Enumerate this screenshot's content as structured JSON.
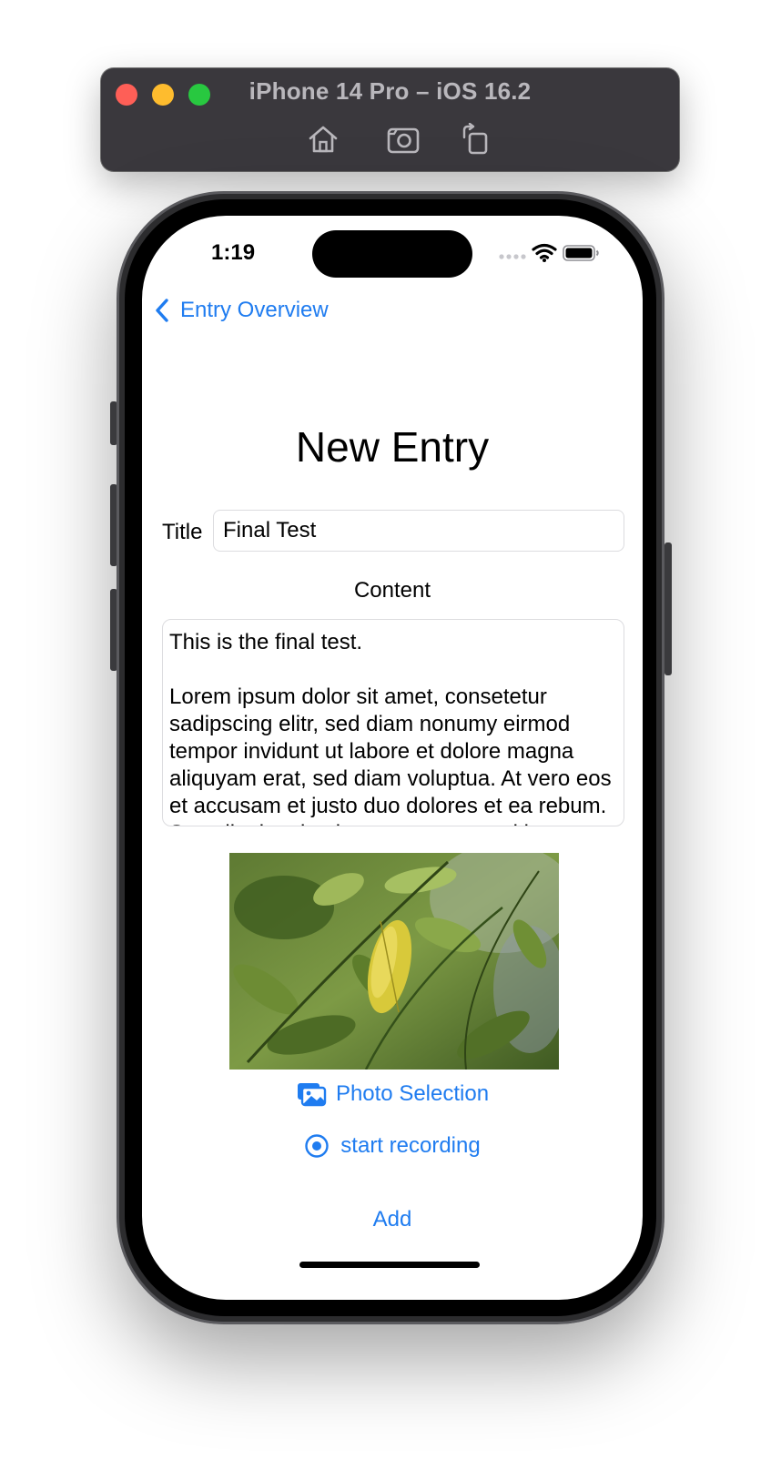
{
  "simulator": {
    "title": "iPhone 14 Pro – iOS 16.2",
    "tools": [
      "home-icon",
      "screenshot-icon",
      "rotate-icon"
    ]
  },
  "status_bar": {
    "time": "1:19",
    "icons": [
      "cellular-dots-icon",
      "wifi-icon",
      "battery-icon"
    ]
  },
  "nav": {
    "back_label": "Entry Overview"
  },
  "form": {
    "heading": "New Entry",
    "title_label": "Title",
    "title_value": "Final Test",
    "content_label": "Content",
    "content_value": "This is the final test.\n\nLorem ipsum dolor sit amet, consetetur sadipscing elitr, sed diam nonumy eirmod tempor invidunt ut labore et dolore magna aliquyam erat, sed diam voluptua. At vero eos et accusam et justo duo dolores et ea rebum. Stet clita kasd gubergren, no sea takimata sanctus est Lorem ipsum dolor sit amet."
  },
  "actions": {
    "photo_selection": "Photo Selection",
    "start_recording": "start recording",
    "add": "Add"
  },
  "colors": {
    "accent": "#1f7cf0",
    "sim_bar": "#3a383d"
  }
}
